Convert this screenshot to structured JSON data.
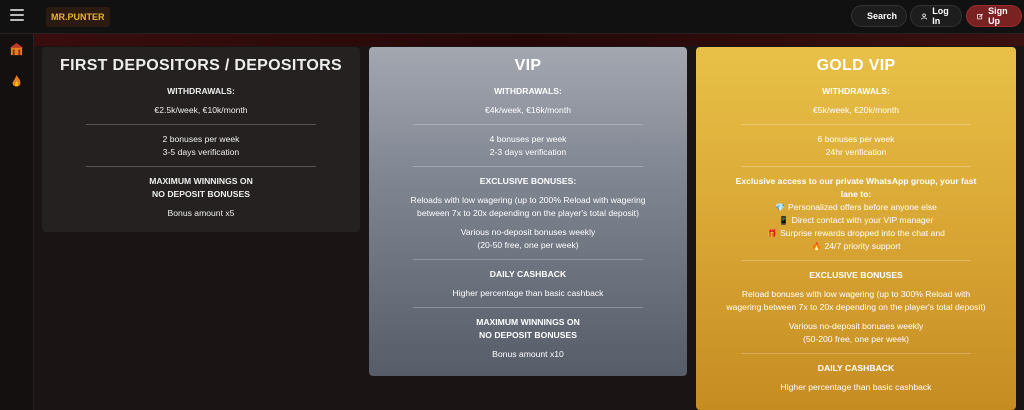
{
  "header": {
    "logo_text": "MR.PUNTER",
    "search_label": "Search",
    "login_label": "Log In",
    "signup_label": "Sign Up"
  },
  "colors": {
    "accent": "#7a2222",
    "gold": "#d9a634",
    "silver": "#8b909a",
    "dark": "#252121"
  },
  "tiers": [
    {
      "title": "FIRST DEPOSITORS / DEPOSITORS",
      "withdrawals_heading": "WITHDRAWALS:",
      "withdrawals_value": "€2.5k/week, €10k/month",
      "bonuses": "2 bonuses per week",
      "verification": "3-5 days verification",
      "max_winnings_heading_1": "MAXIMUM WINNINGS ON",
      "max_winnings_heading_2": "NO DEPOSIT BONUSES",
      "max_winnings_value": "Bonus amount x5"
    },
    {
      "title": "VIP",
      "withdrawals_heading": "WITHDRAWALS:",
      "withdrawals_value": "€4k/week, €16k/month",
      "bonuses": "4 bonuses per week",
      "verification": "2-3 days verification",
      "exclusive_heading": "EXCLUSIVE BONUSES:",
      "exclusive_line_1": "Reloads with low wagering (up to 200% Reload with wagering",
      "exclusive_line_2": "between 7x to 20x depending on the player's total deposit)",
      "no_deposit_line_1": "Various no-deposit bonuses weekly",
      "no_deposit_line_2": "(20-50 free, one per week)",
      "cashback_heading": "DAILY CASHBACK",
      "cashback_value": "Higher percentage than basic cashback",
      "max_winnings_heading_1": "MAXIMUM WINNINGS ON",
      "max_winnings_heading_2": "NO DEPOSIT BONUSES",
      "max_winnings_value": "Bonus amount x10"
    },
    {
      "title": "GOLD VIP",
      "withdrawals_heading": "WITHDRAWALS:",
      "withdrawals_value": "€5k/week, €20k/month",
      "bonuses": "6 bonuses per week",
      "verification": "24hr verification",
      "whatsapp_heading_1": "Exclusive access to our private WhatsApp group, your fast",
      "whatsapp_heading_2": "lane to:",
      "perk_1": "Personalized offers before anyone else",
      "perk_2": "Direct contact with your VIP manager",
      "perk_3": "Surprise rewards dropped into the chat and",
      "perk_4": "24/7 priority support",
      "exclusive_heading": "EXCLUSIVE BONUSES",
      "exclusive_line_1": "Reload bonuses with low wagering (up to 300% Reload with",
      "exclusive_line_2": "wagering between 7x to 20x depending on the player's total deposit)",
      "no_deposit_line_1": "Various no-deposit bonuses weekly",
      "no_deposit_line_2": "(50-200 free, one per week)",
      "cashback_heading": "DAILY CASHBACK",
      "cashback_value": "Higher percentage than basic cashback"
    }
  ]
}
